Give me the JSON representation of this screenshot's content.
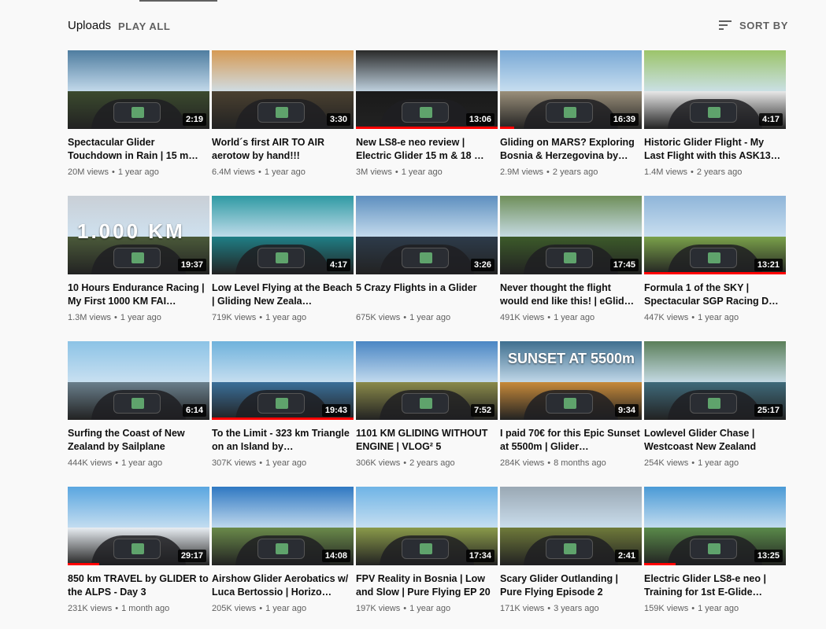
{
  "header": {
    "uploads_label": "Uploads",
    "play_all_label": "PLAY ALL",
    "sort_label": "SORT BY"
  },
  "colors": {
    "progress": "#ff0000",
    "text_primary": "#0f0f0f",
    "text_secondary": "#606060",
    "background": "#f9f9f9"
  },
  "videos": [
    {
      "title": "Spectacular Glider Touchdown in Rain | 15 m…",
      "views": "20M views",
      "age": "1 year ago",
      "duration": "2:19",
      "progress": 0,
      "sky": "#4f7da0",
      "ground": "#3b4a2e",
      "overlay": ""
    },
    {
      "title": "World´s first AIR TO AIR aerotow by hand!!!",
      "views": "6.4M views",
      "age": "1 year ago",
      "duration": "3:30",
      "progress": 0,
      "sky": "#d69a54",
      "ground": "#4a4030",
      "overlay": ""
    },
    {
      "title": "New LS8-e neo review | Electric Glider 15 m & 18 …",
      "views": "3M views",
      "age": "1 year ago",
      "duration": "13:06",
      "progress": 1.0,
      "sky": "#2a2a2a",
      "ground": "#1a1a1a",
      "overlay": ""
    },
    {
      "title": "Gliding on MARS? Exploring Bosnia & Herzegovina by…",
      "views": "2.9M views",
      "age": "2 years ago",
      "duration": "16:39",
      "progress": 0.1,
      "sky": "#7aa9d6",
      "ground": "#9a8f7a",
      "overlay": ""
    },
    {
      "title": "Historic Glider Flight - My Last Flight with this ASK13…",
      "views": "1.4M views",
      "age": "2 years ago",
      "duration": "4:17",
      "progress": 0,
      "sky": "#9cc46a",
      "ground": "#e8e8e8",
      "overlay": ""
    },
    {
      "title": "10 Hours Endurance Racing | My First 1000 KM FAI…",
      "views": "1.3M views",
      "age": "1 year ago",
      "duration": "19:37",
      "progress": 0,
      "sky": "#c9cfd6",
      "ground": "#4b5a3a",
      "overlay": "1.000 KM"
    },
    {
      "title": "Low Level Flying at the Beach | Gliding New Zeala…",
      "views": "719K views",
      "age": "1 year ago",
      "duration": "4:17",
      "progress": 0,
      "sky": "#2f9aa3",
      "ground": "#1f7f86",
      "overlay": ""
    },
    {
      "title": "5 Crazy Flights in a Glider",
      "views": "675K views",
      "age": "1 year ago",
      "duration": "3:26",
      "progress": 0,
      "sky": "#5e8fbf",
      "ground": "#2d3b4a",
      "overlay": ""
    },
    {
      "title": "Never thought the flight would end like this! | eGlid…",
      "views": "491K views",
      "age": "1 year ago",
      "duration": "17:45",
      "progress": 0,
      "sky": "#6f8f5a",
      "ground": "#3c5a2a",
      "overlay": ""
    },
    {
      "title": "Formula 1 of the SKY | Spectacular SGP Racing D…",
      "views": "447K views",
      "age": "1 year ago",
      "duration": "13:21",
      "progress": 1.0,
      "sky": "#8fb5d9",
      "ground": "#7aa14a",
      "overlay": ""
    },
    {
      "title": "Surfing the Coast of New Zealand by Sailplane",
      "views": "444K views",
      "age": "1 year ago",
      "duration": "6:14",
      "progress": 0,
      "sky": "#8cc3e6",
      "ground": "#6a7f8c",
      "overlay": ""
    },
    {
      "title": "To the Limit - 323 km Triangle on an Island by…",
      "views": "307K views",
      "age": "1 year ago",
      "duration": "19:43",
      "progress": 1.0,
      "sky": "#6fb2dc",
      "ground": "#3a6f99",
      "overlay": ""
    },
    {
      "title": "1101 KM GLIDING WITHOUT ENGINE | VLOG² 5",
      "views": "306K views",
      "age": "2 years ago",
      "duration": "7:52",
      "progress": 0,
      "sky": "#4a86c4",
      "ground": "#8a8a4a",
      "overlay": ""
    },
    {
      "title": "I paid 70€ for this Epic Sunset at 5500m | Glider…",
      "views": "284K views",
      "age": "8 months ago",
      "duration": "9:34",
      "progress": 0,
      "sky": "#3f6f8f",
      "ground": "#c78a3a",
      "overlay": "SUNSET AT 5500m"
    },
    {
      "title": "Lowlevel Glider Chase | Westcoast New Zealand",
      "views": "254K views",
      "age": "1 year ago",
      "duration": "25:17",
      "progress": 0,
      "sky": "#5b7f5a",
      "ground": "#3f6a7a",
      "overlay": ""
    },
    {
      "title": "850 km TRAVEL by GLIDER to the ALPS - Day 3",
      "views": "231K views",
      "age": "1 month ago",
      "duration": "29:17",
      "progress": 0.22,
      "sky": "#5aa6e0",
      "ground": "#e9eef3",
      "overlay": ""
    },
    {
      "title": "Airshow Glider Aerobatics w/ Luca Bertossio | Horizo…",
      "views": "205K views",
      "age": "1 year ago",
      "duration": "14:08",
      "progress": 0,
      "sky": "#2f78c2",
      "ground": "#6a8a4a",
      "overlay": ""
    },
    {
      "title": "FPV Reality in Bosnia | Low and Slow | Pure Flying EP 20",
      "views": "197K views",
      "age": "1 year ago",
      "duration": "17:34",
      "progress": 0,
      "sky": "#6fb4e6",
      "ground": "#8a9a4a",
      "overlay": ""
    },
    {
      "title": "Scary Glider Outlanding | Pure Flying Episode 2",
      "views": "171K views",
      "age": "3 years ago",
      "duration": "2:41",
      "progress": 0,
      "sky": "#9aa8b4",
      "ground": "#6f7a3a",
      "overlay": ""
    },
    {
      "title": "Electric Glider LS8-e neo | Training for 1st E-Glide…",
      "views": "159K views",
      "age": "1 year ago",
      "duration": "13:25",
      "progress": 0.22,
      "sky": "#4a9ad6",
      "ground": "#5a8a4a",
      "overlay": ""
    }
  ]
}
